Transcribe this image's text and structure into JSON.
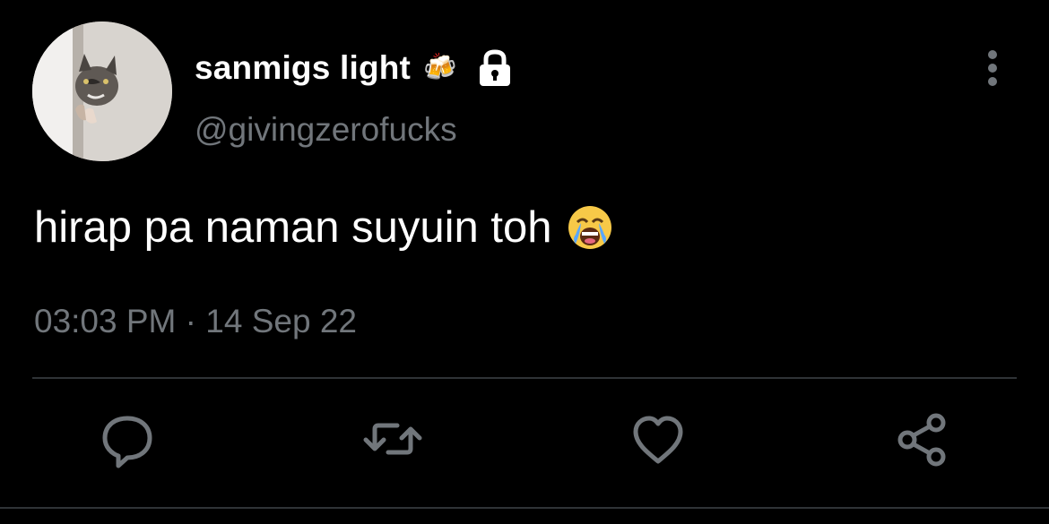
{
  "tweet": {
    "display_name": "sanmigs light",
    "name_emoji": "🍻",
    "username": "@givingzerofucks",
    "text": "hirap pa naman suyuin toh",
    "text_emoji": "😭",
    "time": "03:03 PM",
    "separator": "·",
    "date": "14 Sep 22"
  },
  "icons": {
    "avatar": "cat-peeking-avatar",
    "lock": "lock-icon",
    "more": "vertical-dots-icon",
    "reply": "reply-icon",
    "retweet": "retweet-icon",
    "like": "heart-icon",
    "share": "share-icon"
  },
  "colors": {
    "background": "#000000",
    "primary_text": "#ffffff",
    "secondary_text": "#71767b",
    "divider": "#2f3336",
    "icon": "#71767b"
  }
}
